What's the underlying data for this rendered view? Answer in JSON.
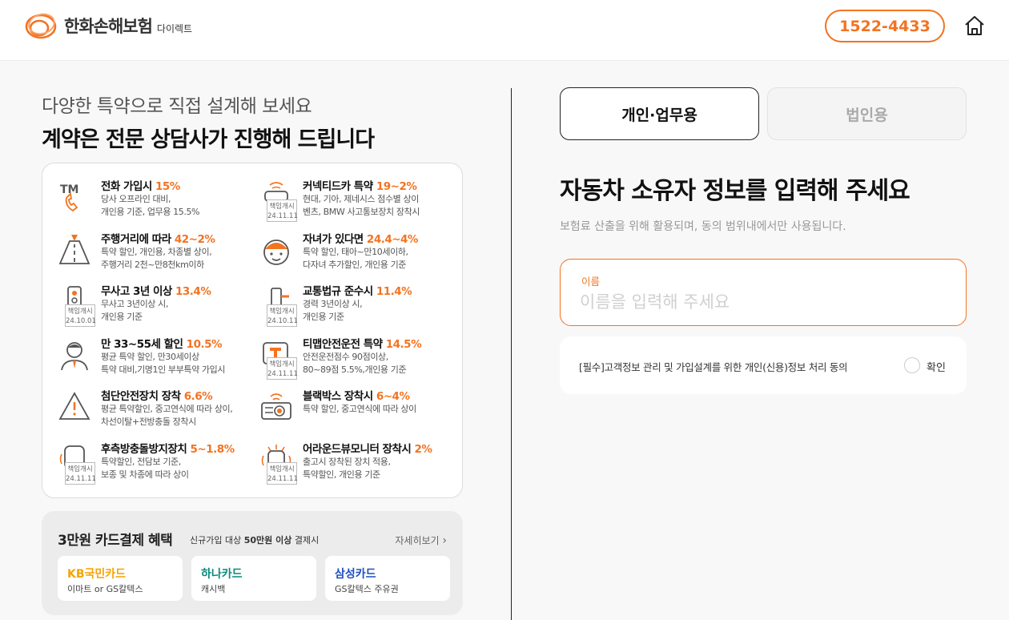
{
  "header": {
    "logo_name": "한화손해보험",
    "logo_sub": "다이렉트",
    "phone": "1522-4433"
  },
  "left": {
    "sub_heading": "다양한 특약으로 직접 설계해 보세요",
    "main_heading": "계약은 전문 상담사가 진행해 드립니다",
    "features": [
      {
        "icon": "tm-phone-icon",
        "title": "전화 가입시 ",
        "highlight": "15%",
        "desc1": "당사 오프라인 대비,",
        "desc2": "개인용 기준, 업무용 15.5%"
      },
      {
        "icon": "connected-car-icon",
        "title": "커넥티드카 특약 ",
        "highlight": "19~2%",
        "desc1": "현대, 기아, 제네시스 점수별 상이",
        "desc2": "벤츠, BMW 사고통보장치 장착시",
        "stamp1": "책임개시",
        "stamp2": "24.11.11"
      },
      {
        "icon": "road-icon",
        "title": "주행거리에 따라 ",
        "highlight": "42~2%",
        "desc1": "특약 할인, 개인용, 차종별 상이,",
        "desc2": "주행거리 2천~만8천km이하"
      },
      {
        "icon": "child-face-icon",
        "title": "자녀가 있다면 ",
        "highlight": "24.4~4%",
        "desc1": "특약 할인, 태아~만10세이하,",
        "desc2": "다자녀 추가할인, 개인용 기준"
      },
      {
        "icon": "traffic-light-icon",
        "title": "무사고 3년 이상 ",
        "highlight": "13.4%",
        "desc1": "무사고 3년이상 시,",
        "desc2": "개인용 기준",
        "stamp1": "책임개시",
        "stamp2": "24.10.01"
      },
      {
        "icon": "traffic-rule-icon",
        "title": "교통법규 준수시 ",
        "highlight": "11.4%",
        "desc1": "경력 3년이상 시,",
        "desc2": "개인용 기준",
        "stamp1": "책임개시",
        "stamp2": "24.10.11"
      },
      {
        "icon": "person-tie-icon",
        "title": "만 33~55세 할인 ",
        "highlight": "10.5%",
        "desc1": "평균 특약 할인, 만30세이상",
        "desc2": "특약 대비,기명1인 부부특약 가입시"
      },
      {
        "icon": "tmap-icon",
        "title": "티맵안전운전 특약 ",
        "highlight": "14.5%",
        "desc1": "안전운전점수 90점이상,",
        "desc2": "80~89점 5.5%,개인용 기준",
        "stamp1": "책임개시",
        "stamp2": "24.11.11"
      },
      {
        "icon": "warning-triangle-icon",
        "title": "첨단안전장치 장착 ",
        "highlight": "6.6%",
        "desc1": "평균 특약할인, 중고연식에 따라 상이,",
        "desc2": "차선이탈+전방충돌 장착시"
      },
      {
        "icon": "blackbox-icon",
        "title": "블랙박스 장착시 ",
        "highlight": "6~4%",
        "desc1": "특약 할인, 중고연식에 따라 상이",
        "desc2": ""
      },
      {
        "icon": "rear-sensor-icon",
        "title": "후측방충돌방지장치 ",
        "highlight": "5~1.8%",
        "desc1": "특약할인, 전담보 기준,",
        "desc2": "보종 및 차종에 따라 상이",
        "stamp1": "책임개시",
        "stamp2": "24.11.11"
      },
      {
        "icon": "around-view-icon",
        "title": "어라운드뷰모니터 장착시 ",
        "highlight": "2%",
        "desc1": "출고시 장착된 장치 적용,",
        "desc2": "특약할인, 개인용 기준",
        "stamp1": "책임개시",
        "stamp2": "24.11.11"
      }
    ],
    "card_promo": {
      "title": "3만원 카드결제 혜택",
      "cond_prefix": "신규가입 대상 ",
      "cond_bold": "50만원 이상",
      "cond_suffix": " 결제시",
      "more": "자세히보기",
      "cards": [
        {
          "name": "KB국민카드",
          "desc": "이마트 or GS칼텍스",
          "color": "#f5a300"
        },
        {
          "name": "하나카드",
          "desc": "캐시백",
          "color": "#0a8a7c"
        },
        {
          "name": "삼성카드",
          "desc": "GS칼텍스 주유권",
          "color": "#1b4fbf"
        }
      ]
    }
  },
  "right": {
    "tab_personal": "개인·업무용",
    "tab_corporate": "법인용",
    "title": "자동차 소유자 정보를 입력해 주세요",
    "desc": "보험료 산출을 위해 활용되며, 동의 범위내에서만 사용됩니다.",
    "name_label": "이름",
    "name_placeholder": "이름을 입력해 주세요",
    "agree_text": "[필수]고객정보 관리 및 가입설계를 위한 개인(신용)정보 처리 동의",
    "agree_confirm": "확인"
  },
  "colors": {
    "accent": "#f37321"
  }
}
